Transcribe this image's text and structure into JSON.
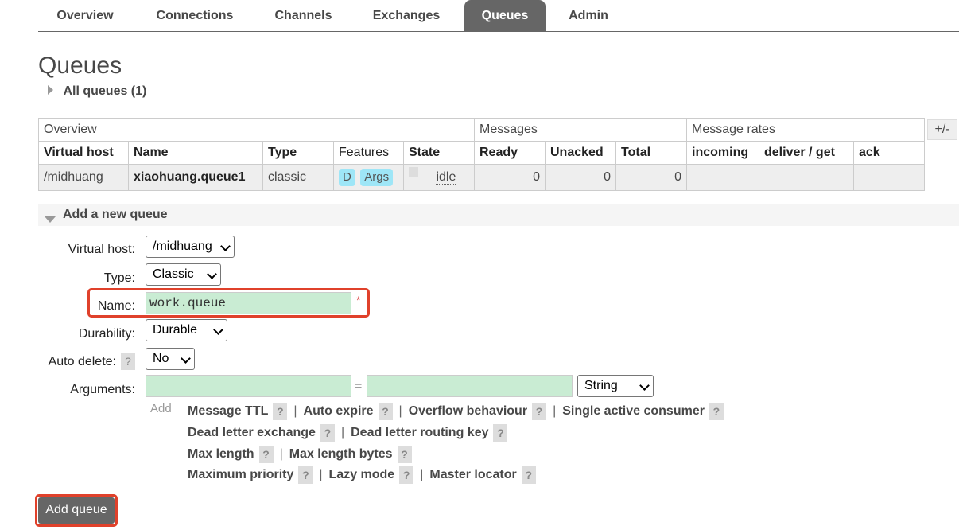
{
  "nav": {
    "tabs": [
      {
        "label": "Overview"
      },
      {
        "label": "Connections"
      },
      {
        "label": "Channels"
      },
      {
        "label": "Exchanges"
      },
      {
        "label": "Queues",
        "active": true
      },
      {
        "label": "Admin"
      }
    ]
  },
  "page": {
    "title": "Queues",
    "all_queues": "All queues (1)"
  },
  "table": {
    "groups": [
      "Overview",
      "Messages",
      "Message rates"
    ],
    "plus_minus": "+/-",
    "columns": [
      "Virtual host",
      "Name",
      "Type",
      "Features",
      "State",
      "Ready",
      "Unacked",
      "Total",
      "incoming",
      "deliver / get",
      "ack"
    ],
    "rows": [
      {
        "vhost": "/midhuang",
        "name": "xiaohuang.queue1",
        "type": "classic",
        "feature_d": "D",
        "feature_args": "Args",
        "state": "idle",
        "ready": "0",
        "unacked": "0",
        "total": "0",
        "incoming": "",
        "deliver_get": "",
        "ack": ""
      }
    ]
  },
  "add_queue": {
    "section_title": "Add a new queue",
    "virtual_host_label": "Virtual host:",
    "virtual_host_value": "/midhuang",
    "type_label": "Type:",
    "type_value": "Classic",
    "name_label": "Name:",
    "name_value": "work.queue",
    "required_mark": "*",
    "durability_label": "Durability:",
    "durability_value": "Durable",
    "auto_delete_label": "Auto delete:",
    "auto_delete_value": "No",
    "arguments_label": "Arguments:",
    "equals": "=",
    "arg_type_value": "String",
    "add_label": "Add",
    "help_mark": "?",
    "arg_links": {
      "message_ttl": "Message TTL",
      "auto_expire": "Auto expire",
      "overflow_behaviour": "Overflow behaviour",
      "single_active_consumer": "Single active consumer",
      "dead_letter_exchange": "Dead letter exchange",
      "dead_letter_routing_key": "Dead letter routing key",
      "max_length": "Max length",
      "max_length_bytes": "Max length bytes",
      "maximum_priority": "Maximum priority",
      "lazy_mode": "Lazy mode",
      "master_locator": "Master locator"
    },
    "separator": "|",
    "submit_label": "Add queue"
  },
  "colors": {
    "accent": "#666666",
    "highlight_box": "#e0412b",
    "input_green": "#c9ecd3",
    "badge_blue": "#9ee6f7"
  }
}
